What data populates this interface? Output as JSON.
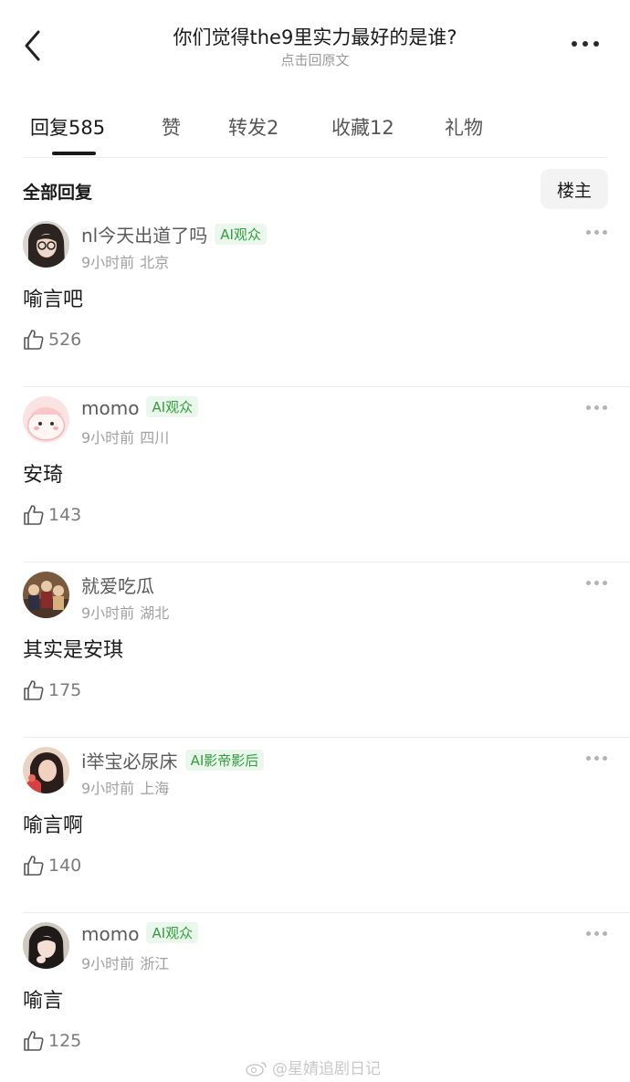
{
  "header": {
    "title": "你们觉得the9里实力最好的是谁?",
    "subtitle": "点击回原文"
  },
  "tabs": [
    {
      "label": "回复585",
      "active": true
    },
    {
      "label": "赞",
      "active": false
    },
    {
      "label": "转发2",
      "active": false
    },
    {
      "label": "收藏12",
      "active": false
    },
    {
      "label": "礼物",
      "active": false
    }
  ],
  "section": {
    "title": "全部回复",
    "host_button": "楼主"
  },
  "comments": [
    {
      "username": "nl今天出道了吗",
      "badge": "AI观众",
      "time": "9小时前",
      "location": "北京",
      "content": "喻言吧",
      "likes": "526"
    },
    {
      "username": "momo",
      "badge": "AI观众",
      "time": "9小时前",
      "location": "四川",
      "content": "安琦",
      "likes": "143"
    },
    {
      "username": "就爱吃瓜",
      "badge": "",
      "time": "9小时前",
      "location": "湖北",
      "content": "其实是安琪",
      "likes": "175"
    },
    {
      "username": "i举宝必尿床",
      "badge": "AI影帝影后",
      "time": "9小时前",
      "location": "上海",
      "content": "喻言啊",
      "likes": "140"
    },
    {
      "username": "momo",
      "badge": "AI观众",
      "time": "9小时前",
      "location": "浙江",
      "content": "喻言",
      "likes": "125"
    }
  ],
  "watermark": "@星婧追剧日记",
  "colors": {
    "badge_text": "#2f9e3b",
    "badge_bg": "#ebf7ec"
  }
}
